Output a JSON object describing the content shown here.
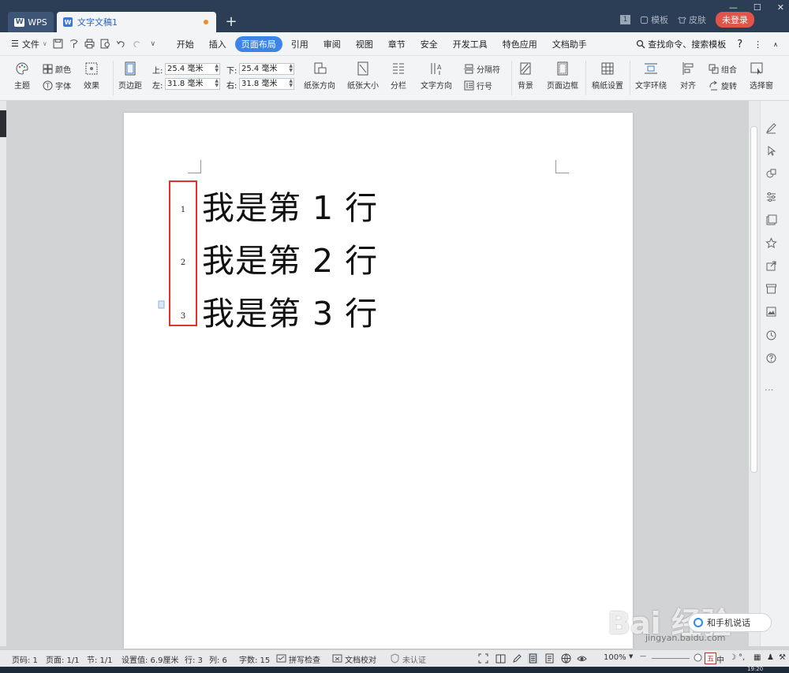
{
  "app": {
    "brand_tab": "WPS",
    "doc_tab": "文字文稿1",
    "new_tab_symbol": "+",
    "window_badge": "1",
    "template_link": "模板",
    "skin_link": "皮肤",
    "login_button": "未登录",
    "window_controls": [
      "—",
      "☐",
      "✕"
    ]
  },
  "menu": {
    "file": "文件",
    "items": [
      "开始",
      "插入",
      "页面布局",
      "引用",
      "审阅",
      "视图",
      "章节",
      "安全",
      "开发工具",
      "特色应用",
      "文档助手"
    ],
    "active_item": "页面布局",
    "search_command": "查找命令、搜索模板",
    "help": "?",
    "more": "⋮"
  },
  "ribbon": {
    "theme": "主题",
    "color": "颜色",
    "font": "字体",
    "effect": "效果",
    "margins": "页边距",
    "top_label": "上:",
    "top_value": "25.4 毫米",
    "bottom_label": "下:",
    "bottom_value": "25.4 毫米",
    "left_label": "左:",
    "left_value": "31.8 毫米",
    "right_label": "右:",
    "right_value": "31.8 毫米",
    "orientation": "纸张方向",
    "paper_size": "纸张大小",
    "columns": "分栏",
    "text_direction": "文字方向",
    "breaks": "分隔符",
    "line_numbers": "行号",
    "background": "背景",
    "page_border": "页面边框",
    "manuscript": "稿纸设置",
    "text_wrap": "文字环绕",
    "align": "对齐",
    "group": "组合",
    "rotate": "旋转",
    "selection_pane": "选择窗"
  },
  "document": {
    "lines": [
      {
        "number": "1",
        "text": "我是第 1 行"
      },
      {
        "number": "2",
        "text": "我是第 2 行"
      },
      {
        "number": "3",
        "text": "我是第 3 行"
      }
    ],
    "highlight_color": "#e3312d"
  },
  "overlay": {
    "watermark": "Bai 经验",
    "watermark_url": "jingyan.baidu.com",
    "phone_chat": "和手机说话"
  },
  "status": {
    "page_no": "页码: 1",
    "pages": "页面: 1/1",
    "section": "节: 1/1",
    "setting": "设置值: 6.9厘米",
    "row": "行: 3",
    "col": "列: 6",
    "word_count": "字数: 15",
    "spell_check": "拼写检查",
    "doc_proof": "文档校对",
    "certification": "未认证",
    "zoom": "100%",
    "zoom_minus": "—",
    "ime": "中",
    "clock": "19:20"
  },
  "colors": {
    "titlebar": "#2c3e55",
    "accent": "#3e84e8",
    "login": "#e0544a"
  }
}
